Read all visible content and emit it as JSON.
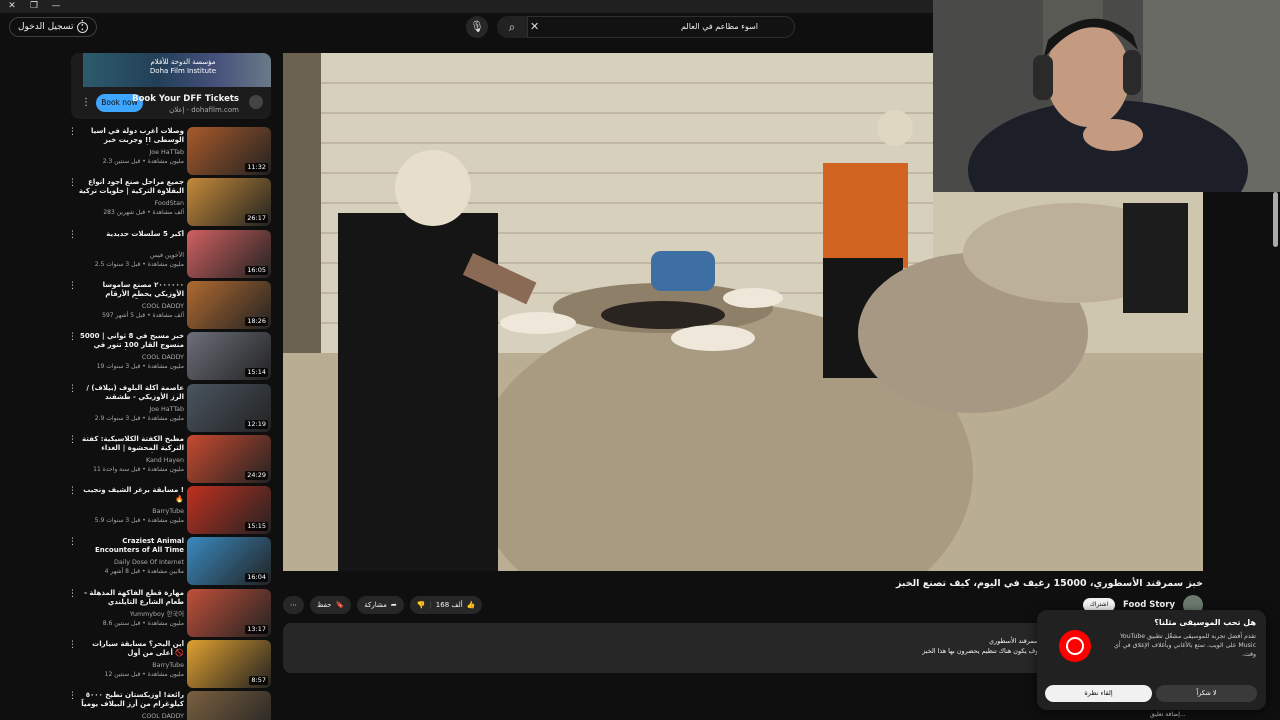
{
  "header": {
    "sign_in_label": "تسجيل الدخول",
    "search_value": "اسوء مطاعم في العالم",
    "more_icon": "kebab-icon"
  },
  "ad": {
    "banner_text": "مؤسسة الدوحة للأفلام Doha Film Institute",
    "title": "Book Your DFF Tickets",
    "domain": "إعلان · dohafilm.com",
    "button_label": "Book now"
  },
  "recommendations": [
    {
      "title": "وصلات أغرب دولة في آسيا الوسطى !! وجربت خبز سمرقند الأسطوري",
      "channel": "Joe HaTTab",
      "meta": "2.3 مليون مشاهدة • قبل سنتين",
      "duration": "11:32",
      "thumb_color": "#a85a2a"
    },
    {
      "title": "جميع مراحل صنع أجود أنواع البقلاوة التركية | حلويات تركية",
      "channel": "FoodStan",
      "meta": "283 ألف مشاهدة • قبل شهرين",
      "duration": "26:17",
      "thumb_color": "#c58a3a"
    },
    {
      "title": "أكبر 5 سلسلات حديدية",
      "channel": "الأخوين فيس",
      "meta": "2.5 مليون مشاهدة • قبل 3 سنوات",
      "duration": "16:05",
      "thumb_color": "#d06060"
    },
    {
      "title": "٢٠٠٠٠٠٠ مصنع ساموسا الأوزبكي يحطم الأرقام القياسية في آسيا الوسطى وأشهر مطاعم...",
      "channel": "COOL DADDY",
      "meta": "597 ألف مشاهدة • قبل 5 أشهر",
      "duration": "18:26",
      "thumb_color": "#b06a30"
    },
    {
      "title": "5000 خبز مسبح في 8 ثواني | منسوج القار 100 تنور في اليوم | المطبخ الأوزبكي",
      "channel": "COOL DADDY",
      "meta": "19 مليون مشاهدة • قبل 3 سنوات",
      "duration": "15:14",
      "thumb_color": "#6c6f7a"
    },
    {
      "title": "عاصمة أكلة البلوف (بيلاف) / الرز الأوزبكي - طشقند",
      "channel": "Joe HaTTab",
      "meta": "2.9 مليون مشاهدة • قبل 3 سنوات",
      "duration": "12:19",
      "thumb_color": "#4a5560"
    },
    {
      "title": "مطبخ الكفتة الكلاسيكية: كفتة التركية المحشوة | الغذاء الشرق الأوسط",
      "channel": "Kand Hayen",
      "meta": "11 مليون مشاهدة • قبل سنة واحدة",
      "duration": "24:29",
      "thumb_color": "#c84a30"
    },
    {
      "title": "مسابقة برغر الشيف ونجيب ! 🔥",
      "channel": "BarryTube",
      "meta": "5.9 مليون مشاهدة • قبل 3 سنوات",
      "duration": "15:15",
      "thumb_color": "#c03020"
    },
    {
      "title": "Craziest Animal Encounters of All Time",
      "channel": "Daily Dose Of Internet",
      "meta": "4 ملايين مشاهدة • قبل 8 أشهر",
      "duration": "16:04",
      "thumb_color": "#3a8ac0"
    },
    {
      "title": "مهارة قطع الفاكهة المذهلة - طعام الشارع التايلندي",
      "channel": "Yummyboy 한국어",
      "meta": "8.6 مليون مشاهدة • قبل سنتين",
      "duration": "13:17",
      "thumb_color": "#c0503a"
    },
    {
      "title": "أين البحر؟ مسابقة سيارات أعلى من أول 🚫",
      "channel": "BarryTube",
      "meta": "12 مليون مشاهدة • قبل سنتين",
      "duration": "8:57",
      "thumb_color": "#e0a030"
    },
    {
      "title": "رائعة! أوزبكستان تطبخ ٥٠٠٠ كيلوغرام من أرز البيلاف يومياً لحفرة الآلاف شخص في ا...",
      "channel": "COOL DADDY",
      "meta": "",
      "duration": "",
      "thumb_color": "#7a6040"
    }
  ],
  "video": {
    "title": "خبز سمرقند الأسطوري، 15000 رغيف في اليوم، كيف تصنع الخبز",
    "channel": "Food Story",
    "subscribe_label": "اشتراك",
    "likes": "168 ألف",
    "share_label": "مشاركة",
    "save_label": "حفظ",
    "description_lines": [
      "...بالمطبخ الشهيرة ، ولكن أيضاً بخبز التنور المسمى خبز سمرقند الأسطوري",
      "منذ العصور القديمة ، ونحن على يقين من أنه سيحدث وسوف يكون هناك تنظيم يحضرون بها هذا الخبز",
      "!"
    ]
  },
  "popup": {
    "title": "هل تحب الموسيقى مثلنا؟",
    "description": "تقدم أفضل تجربة للموسيقى مشغّل تطبيق YouTube Music على الويب. تمتع بالأغاني وبأغلاف الإغلاق في أي وقت.",
    "primary_label": "إلقاء نظرة",
    "secondary_label": "لا شكراً"
  },
  "bottom_hint": "إضافة تعليق..."
}
